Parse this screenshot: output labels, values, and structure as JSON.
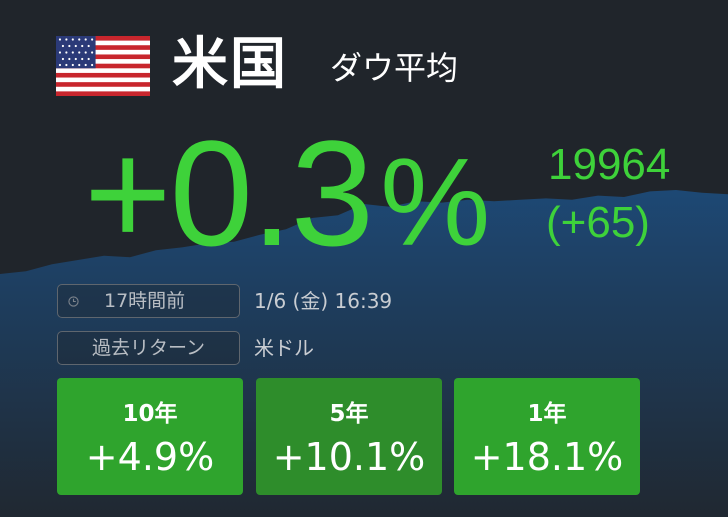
{
  "header": {
    "country": "米国",
    "index_name": "ダウ平均",
    "flag_icon": "us-flag-icon"
  },
  "quote": {
    "change_pct": "+0.3",
    "pct_sign": "%",
    "level": "19964",
    "change_points": "(+65)",
    "color_up": "#3ed23a"
  },
  "meta": {
    "elapsed": "17時間前",
    "datetime": "1/6 (金) 16:39",
    "returns_label": "過去リターン",
    "currency": "米ドル"
  },
  "returns": [
    {
      "period": "10年",
      "value": "+4.9%"
    },
    {
      "period": "5年",
      "value": "+10.1%"
    },
    {
      "period": "1年",
      "value": "+18.1%"
    }
  ],
  "colors": {
    "background": "#20252b",
    "card_green": "#2fa42d",
    "card_green_dark": "#2e8d2b",
    "area_chart": "#1d4a78"
  },
  "chart_data": {
    "type": "area",
    "values": [
      40,
      42,
      47,
      50,
      53,
      52,
      57,
      59,
      62,
      63,
      68,
      72,
      80,
      82,
      90,
      88,
      92,
      91,
      93,
      92,
      93,
      94,
      93,
      96,
      95,
      99,
      100,
      98,
      97
    ],
    "ylim": [
      0,
      100
    ]
  }
}
